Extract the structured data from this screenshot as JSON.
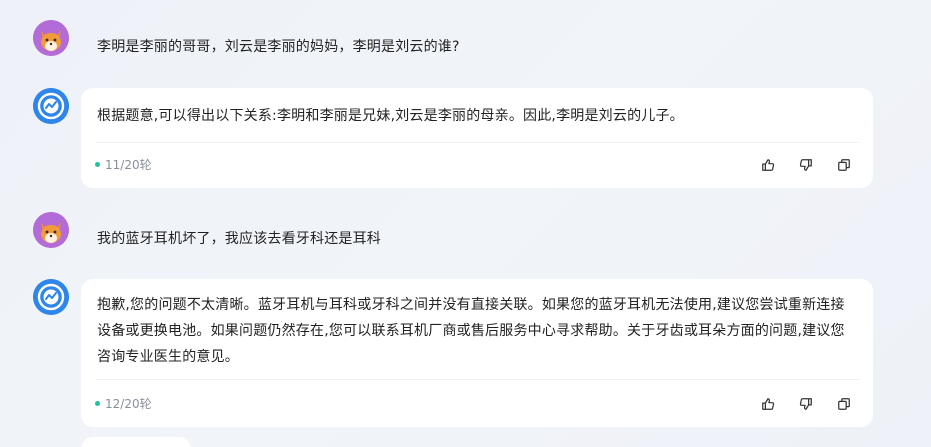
{
  "messages": [
    {
      "role": "user",
      "text": "李明是李丽的哥哥，刘云是李丽的妈妈，李明是刘云的谁?"
    },
    {
      "role": "assistant",
      "text": "根据题意,可以得出以下关系:李明和李丽是兄妹,刘云是李丽的母亲。因此,李明是刘云的儿子。",
      "round": "11/20轮"
    },
    {
      "role": "user",
      "text": "我的蓝牙耳机坏了，我应该去看牙科还是耳科"
    },
    {
      "role": "assistant",
      "text": "抱歉,您的问题不太清晰。蓝牙耳机与耳科或牙科之间并没有直接关联。如果您的蓝牙耳机无法使用,建议您尝试重新连接设备或更换电池。如果问题仍然存在,您可以联系耳机厂商或售后服务中心寻求帮助。关于牙齿或耳朵方面的问题,建议您咨询专业医生的意见。",
      "round": "12/20轮"
    }
  ],
  "icons": {
    "like": "thumbs-up-icon",
    "dislike": "thumbs-down-icon",
    "copy": "copy-icon"
  },
  "colors": {
    "round_dot": "#1fc39a",
    "bot_avatar": "#2f86ea",
    "user_avatar": "#b36bd8"
  }
}
